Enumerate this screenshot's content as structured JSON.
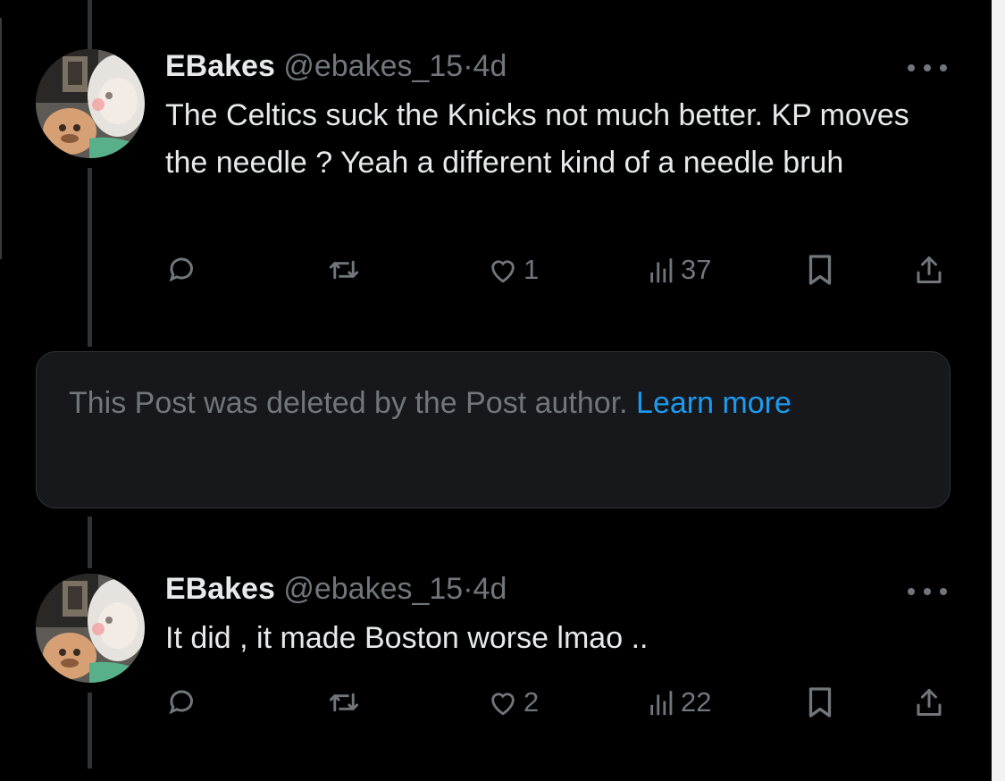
{
  "colors": {
    "background": "#000000",
    "text": "#e7e9ea",
    "muted": "#71767b",
    "link": "#1d9bf0",
    "card": "#16181c"
  },
  "tweets": [
    {
      "name": "EBakes",
      "handle": "@ebakes_15",
      "separator": "·",
      "age": "4d",
      "text": "The Celtics suck the Knicks not much better. KP moves the needle ? Yeah a different kind of a needle bruh",
      "likes": "1",
      "views": "37",
      "icons": [
        "reply-icon",
        "retweet-icon",
        "like-icon",
        "views-icon",
        "bookmark-icon",
        "share-icon"
      ]
    },
    {
      "name": "EBakes",
      "handle": "@ebakes_15",
      "separator": "·",
      "age": "4d",
      "text": "It did , it made Boston worse lmao ..",
      "likes": "2",
      "views": "22",
      "icons": [
        "reply-icon",
        "retweet-icon",
        "like-icon",
        "views-icon",
        "bookmark-icon",
        "share-icon"
      ]
    }
  ],
  "deleted_notice": {
    "text": "This Post was deleted by the Post author.",
    "link": "Learn more"
  }
}
